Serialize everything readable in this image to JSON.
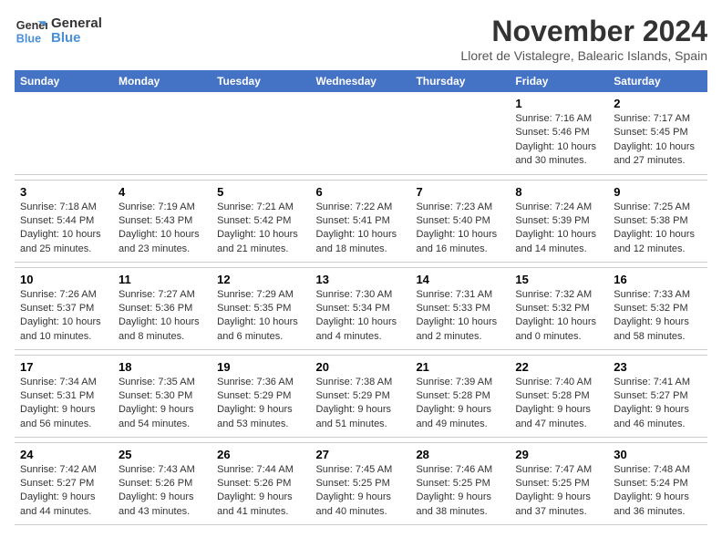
{
  "logo": {
    "line1": "General",
    "line2": "Blue"
  },
  "title": "November 2024",
  "location": "Lloret de Vistalegre, Balearic Islands, Spain",
  "weekdays": [
    "Sunday",
    "Monday",
    "Tuesday",
    "Wednesday",
    "Thursday",
    "Friday",
    "Saturday"
  ],
  "weeks": [
    [
      {
        "day": "",
        "info": ""
      },
      {
        "day": "",
        "info": ""
      },
      {
        "day": "",
        "info": ""
      },
      {
        "day": "",
        "info": ""
      },
      {
        "day": "",
        "info": ""
      },
      {
        "day": "1",
        "info": "Sunrise: 7:16 AM\nSunset: 5:46 PM\nDaylight: 10 hours and 30 minutes."
      },
      {
        "day": "2",
        "info": "Sunrise: 7:17 AM\nSunset: 5:45 PM\nDaylight: 10 hours and 27 minutes."
      }
    ],
    [
      {
        "day": "3",
        "info": "Sunrise: 7:18 AM\nSunset: 5:44 PM\nDaylight: 10 hours and 25 minutes."
      },
      {
        "day": "4",
        "info": "Sunrise: 7:19 AM\nSunset: 5:43 PM\nDaylight: 10 hours and 23 minutes."
      },
      {
        "day": "5",
        "info": "Sunrise: 7:21 AM\nSunset: 5:42 PM\nDaylight: 10 hours and 21 minutes."
      },
      {
        "day": "6",
        "info": "Sunrise: 7:22 AM\nSunset: 5:41 PM\nDaylight: 10 hours and 18 minutes."
      },
      {
        "day": "7",
        "info": "Sunrise: 7:23 AM\nSunset: 5:40 PM\nDaylight: 10 hours and 16 minutes."
      },
      {
        "day": "8",
        "info": "Sunrise: 7:24 AM\nSunset: 5:39 PM\nDaylight: 10 hours and 14 minutes."
      },
      {
        "day": "9",
        "info": "Sunrise: 7:25 AM\nSunset: 5:38 PM\nDaylight: 10 hours and 12 minutes."
      }
    ],
    [
      {
        "day": "10",
        "info": "Sunrise: 7:26 AM\nSunset: 5:37 PM\nDaylight: 10 hours and 10 minutes."
      },
      {
        "day": "11",
        "info": "Sunrise: 7:27 AM\nSunset: 5:36 PM\nDaylight: 10 hours and 8 minutes."
      },
      {
        "day": "12",
        "info": "Sunrise: 7:29 AM\nSunset: 5:35 PM\nDaylight: 10 hours and 6 minutes."
      },
      {
        "day": "13",
        "info": "Sunrise: 7:30 AM\nSunset: 5:34 PM\nDaylight: 10 hours and 4 minutes."
      },
      {
        "day": "14",
        "info": "Sunrise: 7:31 AM\nSunset: 5:33 PM\nDaylight: 10 hours and 2 minutes."
      },
      {
        "day": "15",
        "info": "Sunrise: 7:32 AM\nSunset: 5:32 PM\nDaylight: 10 hours and 0 minutes."
      },
      {
        "day": "16",
        "info": "Sunrise: 7:33 AM\nSunset: 5:32 PM\nDaylight: 9 hours and 58 minutes."
      }
    ],
    [
      {
        "day": "17",
        "info": "Sunrise: 7:34 AM\nSunset: 5:31 PM\nDaylight: 9 hours and 56 minutes."
      },
      {
        "day": "18",
        "info": "Sunrise: 7:35 AM\nSunset: 5:30 PM\nDaylight: 9 hours and 54 minutes."
      },
      {
        "day": "19",
        "info": "Sunrise: 7:36 AM\nSunset: 5:29 PM\nDaylight: 9 hours and 53 minutes."
      },
      {
        "day": "20",
        "info": "Sunrise: 7:38 AM\nSunset: 5:29 PM\nDaylight: 9 hours and 51 minutes."
      },
      {
        "day": "21",
        "info": "Sunrise: 7:39 AM\nSunset: 5:28 PM\nDaylight: 9 hours and 49 minutes."
      },
      {
        "day": "22",
        "info": "Sunrise: 7:40 AM\nSunset: 5:28 PM\nDaylight: 9 hours and 47 minutes."
      },
      {
        "day": "23",
        "info": "Sunrise: 7:41 AM\nSunset: 5:27 PM\nDaylight: 9 hours and 46 minutes."
      }
    ],
    [
      {
        "day": "24",
        "info": "Sunrise: 7:42 AM\nSunset: 5:27 PM\nDaylight: 9 hours and 44 minutes."
      },
      {
        "day": "25",
        "info": "Sunrise: 7:43 AM\nSunset: 5:26 PM\nDaylight: 9 hours and 43 minutes."
      },
      {
        "day": "26",
        "info": "Sunrise: 7:44 AM\nSunset: 5:26 PM\nDaylight: 9 hours and 41 minutes."
      },
      {
        "day": "27",
        "info": "Sunrise: 7:45 AM\nSunset: 5:25 PM\nDaylight: 9 hours and 40 minutes."
      },
      {
        "day": "28",
        "info": "Sunrise: 7:46 AM\nSunset: 5:25 PM\nDaylight: 9 hours and 38 minutes."
      },
      {
        "day": "29",
        "info": "Sunrise: 7:47 AM\nSunset: 5:25 PM\nDaylight: 9 hours and 37 minutes."
      },
      {
        "day": "30",
        "info": "Sunrise: 7:48 AM\nSunset: 5:24 PM\nDaylight: 9 hours and 36 minutes."
      }
    ]
  ]
}
